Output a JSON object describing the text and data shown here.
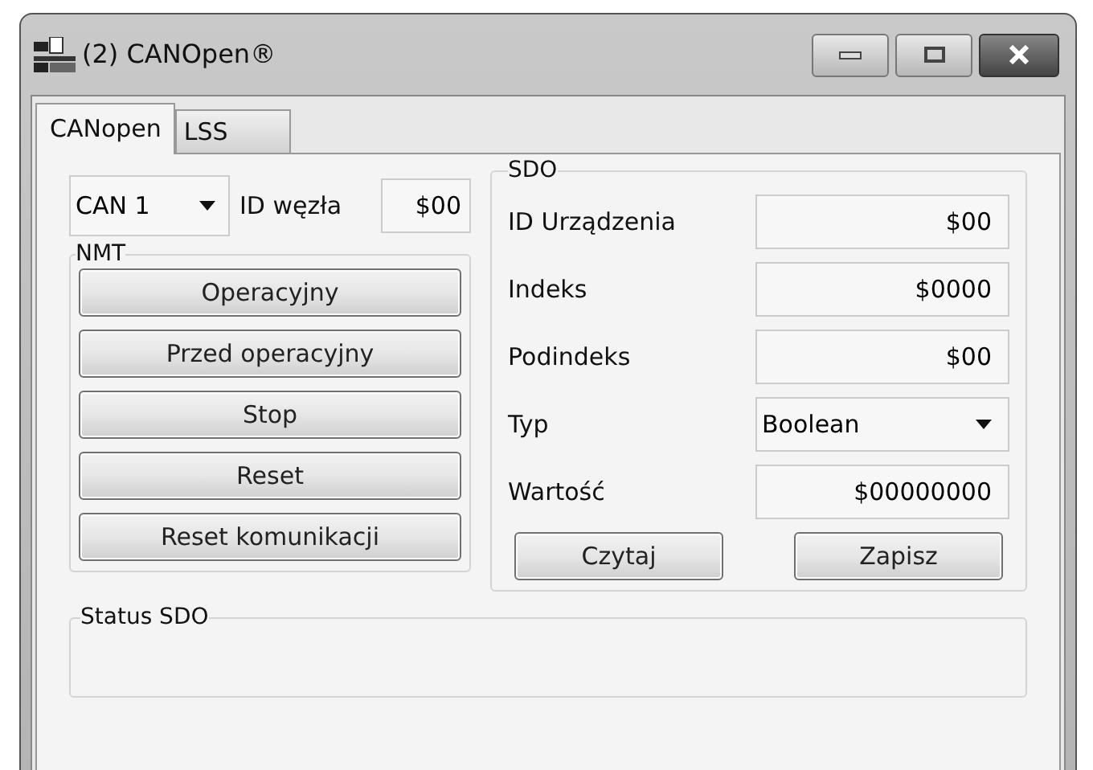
{
  "window": {
    "title": "(2) CANOpen®"
  },
  "tabs": [
    {
      "label": "CANopen",
      "selected": true
    },
    {
      "label": "LSS",
      "selected": false
    }
  ],
  "port": {
    "value": "CAN 1"
  },
  "node_id": {
    "label": "ID węzła",
    "value": "$00"
  },
  "nmt": {
    "title": "NMT",
    "buttons": [
      "Operacyjny",
      "Przed operacyjny",
      "Stop",
      "Reset",
      "Reset komunikacji"
    ]
  },
  "sdo": {
    "title": "SDO",
    "fields": [
      {
        "label": "ID Urządzenia",
        "kind": "text",
        "value": "$00"
      },
      {
        "label": "Indeks",
        "kind": "text",
        "value": "$0000"
      },
      {
        "label": "Podindeks",
        "kind": "text",
        "value": "$00"
      },
      {
        "label": "Typ",
        "kind": "dropdown",
        "value": "Boolean"
      },
      {
        "label": "Wartość",
        "kind": "text",
        "value": "$00000000"
      }
    ],
    "buttons": [
      "Czytaj",
      "Zapisz"
    ]
  },
  "status": {
    "title": "Status SDO"
  }
}
